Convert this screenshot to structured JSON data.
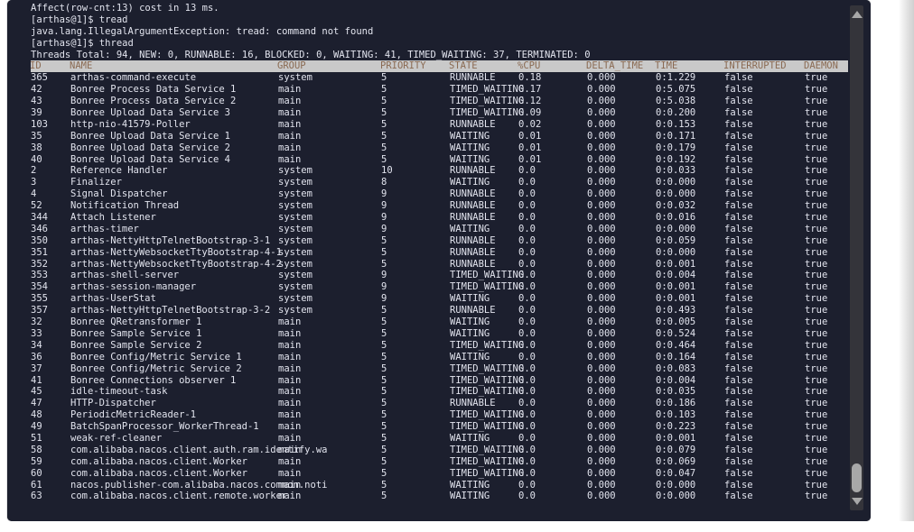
{
  "terminal": {
    "preamble_lines": [
      "Affect(row-cnt:13) cost in 13 ms.",
      "[arthas@1]$ tread",
      "java.lang.IllegalArgumentException: tread: command not found",
      "[arthas@1]$ thread",
      "Threads Total: 94, NEW: 0, RUNNABLE: 16, BLOCKED: 0, WAITING: 41, TIMED_WAITING: 37, TERMINATED: 0"
    ],
    "summary": {
      "total": 94,
      "new": 0,
      "runnable": 16,
      "blocked": 0,
      "waiting": 41,
      "timed_waiting": 37,
      "terminated": 0
    },
    "prompt": "[arthas@1]$",
    "columns": [
      "ID",
      "NAME",
      "GROUP",
      "PRIORITY",
      "STATE",
      "%CPU",
      "DELTA_TIME",
      "TIME",
      "INTERRUPTED",
      "DAEMON"
    ],
    "rows": [
      {
        "id": "365",
        "name": "arthas-command-execute",
        "group": "system",
        "priority": "5",
        "state": "RUNNABLE",
        "cpu": "0.18",
        "delta": "0.000",
        "time": "0:1.229",
        "interrupted": "false",
        "daemon": "true"
      },
      {
        "id": "42",
        "name": "Bonree Process Data Service 1",
        "group": "main",
        "priority": "5",
        "state": "TIMED_WAITING",
        "cpu": "0.17",
        "delta": "0.000",
        "time": "0:5.075",
        "interrupted": "false",
        "daemon": "true"
      },
      {
        "id": "43",
        "name": "Bonree Process Data Service 2",
        "group": "main",
        "priority": "5",
        "state": "TIMED_WAITING",
        "cpu": "0.12",
        "delta": "0.000",
        "time": "0:5.038",
        "interrupted": "false",
        "daemon": "true"
      },
      {
        "id": "39",
        "name": "Bonree Upload Data Service 3",
        "group": "main",
        "priority": "5",
        "state": "TIMED_WAITING",
        "cpu": "0.09",
        "delta": "0.000",
        "time": "0:0.200",
        "interrupted": "false",
        "daemon": "true"
      },
      {
        "id": "103",
        "name": "http-nio-41579-Poller",
        "group": "main",
        "priority": "5",
        "state": "RUNNABLE",
        "cpu": "0.02",
        "delta": "0.000",
        "time": "0:0.153",
        "interrupted": "false",
        "daemon": "true"
      },
      {
        "id": "35",
        "name": "Bonree Upload Data Service 1",
        "group": "main",
        "priority": "5",
        "state": "WAITING",
        "cpu": "0.01",
        "delta": "0.000",
        "time": "0:0.171",
        "interrupted": "false",
        "daemon": "true"
      },
      {
        "id": "38",
        "name": "Bonree Upload Data Service 2",
        "group": "main",
        "priority": "5",
        "state": "WAITING",
        "cpu": "0.01",
        "delta": "0.000",
        "time": "0:0.179",
        "interrupted": "false",
        "daemon": "true"
      },
      {
        "id": "40",
        "name": "Bonree Upload Data Service 4",
        "group": "main",
        "priority": "5",
        "state": "WAITING",
        "cpu": "0.01",
        "delta": "0.000",
        "time": "0:0.192",
        "interrupted": "false",
        "daemon": "true"
      },
      {
        "id": "2",
        "name": "Reference Handler",
        "group": "system",
        "priority": "10",
        "state": "RUNNABLE",
        "cpu": "0.0",
        "delta": "0.000",
        "time": "0:0.033",
        "interrupted": "false",
        "daemon": "true"
      },
      {
        "id": "3",
        "name": "Finalizer",
        "group": "system",
        "priority": "8",
        "state": "WAITING",
        "cpu": "0.0",
        "delta": "0.000",
        "time": "0:0.000",
        "interrupted": "false",
        "daemon": "true"
      },
      {
        "id": "4",
        "name": "Signal Dispatcher",
        "group": "system",
        "priority": "9",
        "state": "RUNNABLE",
        "cpu": "0.0",
        "delta": "0.000",
        "time": "0:0.000",
        "interrupted": "false",
        "daemon": "true"
      },
      {
        "id": "52",
        "name": "Notification Thread",
        "group": "system",
        "priority": "9",
        "state": "RUNNABLE",
        "cpu": "0.0",
        "delta": "0.000",
        "time": "0:0.032",
        "interrupted": "false",
        "daemon": "true"
      },
      {
        "id": "344",
        "name": "Attach Listener",
        "group": "system",
        "priority": "9",
        "state": "RUNNABLE",
        "cpu": "0.0",
        "delta": "0.000",
        "time": "0:0.016",
        "interrupted": "false",
        "daemon": "true"
      },
      {
        "id": "346",
        "name": "arthas-timer",
        "group": "system",
        "priority": "9",
        "state": "WAITING",
        "cpu": "0.0",
        "delta": "0.000",
        "time": "0:0.000",
        "interrupted": "false",
        "daemon": "true"
      },
      {
        "id": "350",
        "name": "arthas-NettyHttpTelnetBootstrap-3-1",
        "group": "system",
        "priority": "5",
        "state": "RUNNABLE",
        "cpu": "0.0",
        "delta": "0.000",
        "time": "0:0.059",
        "interrupted": "false",
        "daemon": "true"
      },
      {
        "id": "351",
        "name": "arthas-NettyWebsocketTtyBootstrap-4-1",
        "group": "system",
        "priority": "5",
        "state": "RUNNABLE",
        "cpu": "0.0",
        "delta": "0.000",
        "time": "0:0.000",
        "interrupted": "false",
        "daemon": "true"
      },
      {
        "id": "352",
        "name": "arthas-NettyWebsocketTtyBootstrap-4-2",
        "group": "system",
        "priority": "5",
        "state": "RUNNABLE",
        "cpu": "0.0",
        "delta": "0.000",
        "time": "0:0.001",
        "interrupted": "false",
        "daemon": "true"
      },
      {
        "id": "353",
        "name": "arthas-shell-server",
        "group": "system",
        "priority": "9",
        "state": "TIMED_WAITING",
        "cpu": "0.0",
        "delta": "0.000",
        "time": "0:0.004",
        "interrupted": "false",
        "daemon": "true"
      },
      {
        "id": "354",
        "name": "arthas-session-manager",
        "group": "system",
        "priority": "9",
        "state": "TIMED_WAITING",
        "cpu": "0.0",
        "delta": "0.000",
        "time": "0:0.001",
        "interrupted": "false",
        "daemon": "true"
      },
      {
        "id": "355",
        "name": "arthas-UserStat",
        "group": "system",
        "priority": "9",
        "state": "WAITING",
        "cpu": "0.0",
        "delta": "0.000",
        "time": "0:0.001",
        "interrupted": "false",
        "daemon": "true"
      },
      {
        "id": "357",
        "name": "arthas-NettyHttpTelnetBootstrap-3-2",
        "group": "system",
        "priority": "5",
        "state": "RUNNABLE",
        "cpu": "0.0",
        "delta": "0.000",
        "time": "0:0.493",
        "interrupted": "false",
        "daemon": "true"
      },
      {
        "id": "32",
        "name": "Bonree QRetransformer 1",
        "group": "main",
        "priority": "5",
        "state": "WAITING",
        "cpu": "0.0",
        "delta": "0.000",
        "time": "0:0.005",
        "interrupted": "false",
        "daemon": "true"
      },
      {
        "id": "33",
        "name": "Bonree Sample Service 1",
        "group": "main",
        "priority": "5",
        "state": "WAITING",
        "cpu": "0.0",
        "delta": "0.000",
        "time": "0:0.524",
        "interrupted": "false",
        "daemon": "true"
      },
      {
        "id": "34",
        "name": "Bonree Sample Service 2",
        "group": "main",
        "priority": "5",
        "state": "TIMED_WAITING",
        "cpu": "0.0",
        "delta": "0.000",
        "time": "0:0.464",
        "interrupted": "false",
        "daemon": "true"
      },
      {
        "id": "36",
        "name": "Bonree Config/Metric Service 1",
        "group": "main",
        "priority": "5",
        "state": "WAITING",
        "cpu": "0.0",
        "delta": "0.000",
        "time": "0:0.164",
        "interrupted": "false",
        "daemon": "true"
      },
      {
        "id": "37",
        "name": "Bonree Config/Metric Service 2",
        "group": "main",
        "priority": "5",
        "state": "TIMED_WAITING",
        "cpu": "0.0",
        "delta": "0.000",
        "time": "0:0.083",
        "interrupted": "false",
        "daemon": "true"
      },
      {
        "id": "41",
        "name": "Bonree Connections observer 1",
        "group": "main",
        "priority": "5",
        "state": "TIMED_WAITING",
        "cpu": "0.0",
        "delta": "0.000",
        "time": "0:0.004",
        "interrupted": "false",
        "daemon": "true"
      },
      {
        "id": "45",
        "name": "idle-timeout-task",
        "group": "main",
        "priority": "5",
        "state": "TIMED_WAITING",
        "cpu": "0.0",
        "delta": "0.000",
        "time": "0:0.035",
        "interrupted": "false",
        "daemon": "true"
      },
      {
        "id": "47",
        "name": "HTTP-Dispatcher",
        "group": "main",
        "priority": "5",
        "state": "RUNNABLE",
        "cpu": "0.0",
        "delta": "0.000",
        "time": "0:0.186",
        "interrupted": "false",
        "daemon": "true"
      },
      {
        "id": "48",
        "name": "PeriodicMetricReader-1",
        "group": "main",
        "priority": "5",
        "state": "TIMED_WAITING",
        "cpu": "0.0",
        "delta": "0.000",
        "time": "0:0.103",
        "interrupted": "false",
        "daemon": "true"
      },
      {
        "id": "49",
        "name": "BatchSpanProcessor_WorkerThread-1",
        "group": "main",
        "priority": "5",
        "state": "TIMED_WAITING",
        "cpu": "0.0",
        "delta": "0.000",
        "time": "0:0.223",
        "interrupted": "false",
        "daemon": "true"
      },
      {
        "id": "51",
        "name": "weak-ref-cleaner",
        "group": "main",
        "priority": "5",
        "state": "WAITING",
        "cpu": "0.0",
        "delta": "0.000",
        "time": "0:0.001",
        "interrupted": "false",
        "daemon": "true"
      },
      {
        "id": "58",
        "name": "com.alibaba.nacos.client.auth.ram.identify.wa",
        "group": "main",
        "priority": "5",
        "state": "TIMED_WAITING",
        "cpu": "0.0",
        "delta": "0.000",
        "time": "0:0.079",
        "interrupted": "false",
        "daemon": "true"
      },
      {
        "id": "59",
        "name": "com.alibaba.nacos.client.Worker",
        "group": "main",
        "priority": "5",
        "state": "TIMED_WAITING",
        "cpu": "0.0",
        "delta": "0.000",
        "time": "0:0.069",
        "interrupted": "false",
        "daemon": "true"
      },
      {
        "id": "60",
        "name": "com.alibaba.nacos.client.Worker",
        "group": "main",
        "priority": "5",
        "state": "TIMED_WAITING",
        "cpu": "0.0",
        "delta": "0.000",
        "time": "0:0.047",
        "interrupted": "false",
        "daemon": "true"
      },
      {
        "id": "61",
        "name": "nacos.publisher-com.alibaba.nacos.common.noti",
        "group": "main",
        "priority": "5",
        "state": "WAITING",
        "cpu": "0.0",
        "delta": "0.000",
        "time": "0:0.000",
        "interrupted": "false",
        "daemon": "true"
      },
      {
        "id": "63",
        "name": "com.alibaba.nacos.client.remote.worker",
        "group": "main",
        "priority": "5",
        "state": "WAITING",
        "cpu": "0.0",
        "delta": "0.000",
        "time": "0:0.000",
        "interrupted": "false",
        "daemon": "true"
      }
    ]
  },
  "scrollbar": {
    "up_arrow": "▲",
    "down_arrow": "▼"
  },
  "colors": {
    "terminal_bg": "#1c1f2e",
    "text": "#e2e4ee",
    "header_bg": "#c9c9c9",
    "header_text": "#8a6a52",
    "runnable": "#2ee06a",
    "waiting": "#d2cb34",
    "timed_waiting": "#e342c8"
  }
}
